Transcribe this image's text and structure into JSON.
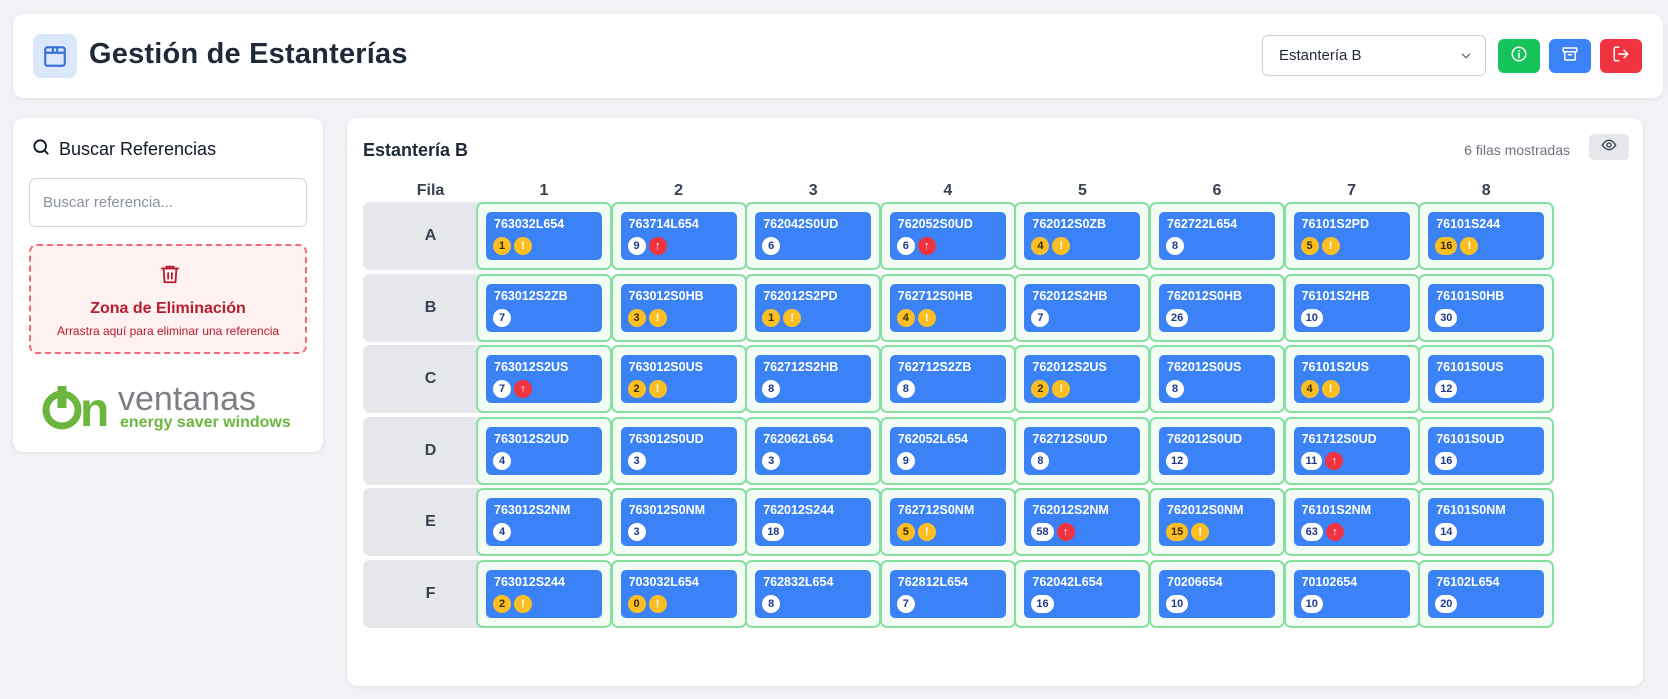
{
  "header": {
    "title": "Gestión de Estanterías",
    "selected_shelf": "Estantería B",
    "icons": [
      "package-icon",
      "info-icon",
      "archive-icon",
      "logout-icon"
    ]
  },
  "sidebar": {
    "search_title": "Buscar Referencias",
    "search_placeholder": "Buscar referencia...",
    "delete_zone_title": "Zona de Eliminación",
    "delete_zone_hint": "Arrastra aquí para eliminar una referencia",
    "brand_on": "on",
    "brand_name": "ventanas",
    "brand_tagline": "energy saver windows"
  },
  "main": {
    "title": "Estantería B",
    "rows_shown": "6 filas mostradas",
    "row_header_label": "Fila",
    "columns": [
      "1",
      "2",
      "3",
      "4",
      "5",
      "6",
      "7",
      "8"
    ],
    "rows": [
      {
        "label": "A",
        "cells": [
          {
            "ref": "763032L654",
            "qty": "1",
            "status": "warn"
          },
          {
            "ref": "763714L654",
            "qty": "9",
            "status": "up"
          },
          {
            "ref": "762042S0UD",
            "qty": "6",
            "status": "ok"
          },
          {
            "ref": "762052S0UD",
            "qty": "6",
            "status": "up"
          },
          {
            "ref": "762012S0ZB",
            "qty": "4",
            "status": "warn"
          },
          {
            "ref": "762722L654",
            "qty": "8",
            "status": "ok"
          },
          {
            "ref": "76101S2PD",
            "qty": "5",
            "status": "warn"
          },
          {
            "ref": "76101S244",
            "qty": "16",
            "status": "warn"
          }
        ]
      },
      {
        "label": "B",
        "cells": [
          {
            "ref": "763012S2ZB",
            "qty": "7",
            "status": "ok"
          },
          {
            "ref": "763012S0HB",
            "qty": "3",
            "status": "warn"
          },
          {
            "ref": "762012S2PD",
            "qty": "1",
            "status": "warn"
          },
          {
            "ref": "762712S0HB",
            "qty": "4",
            "status": "warn"
          },
          {
            "ref": "762012S2HB",
            "qty": "7",
            "status": "ok"
          },
          {
            "ref": "762012S0HB",
            "qty": "26",
            "status": "ok"
          },
          {
            "ref": "76101S2HB",
            "qty": "10",
            "status": "ok"
          },
          {
            "ref": "76101S0HB",
            "qty": "30",
            "status": "ok"
          }
        ]
      },
      {
        "label": "C",
        "cells": [
          {
            "ref": "763012S2US",
            "qty": "7",
            "status": "up"
          },
          {
            "ref": "763012S0US",
            "qty": "2",
            "status": "warn"
          },
          {
            "ref": "762712S2HB",
            "qty": "8",
            "status": "ok"
          },
          {
            "ref": "762712S2ZB",
            "qty": "8",
            "status": "ok"
          },
          {
            "ref": "762012S2US",
            "qty": "2",
            "status": "warn"
          },
          {
            "ref": "762012S0US",
            "qty": "8",
            "status": "ok"
          },
          {
            "ref": "76101S2US",
            "qty": "4",
            "status": "warn"
          },
          {
            "ref": "76101S0US",
            "qty": "12",
            "status": "ok"
          }
        ]
      },
      {
        "label": "D",
        "cells": [
          {
            "ref": "763012S2UD",
            "qty": "4",
            "status": "ok"
          },
          {
            "ref": "763012S0UD",
            "qty": "3",
            "status": "ok"
          },
          {
            "ref": "762062L654",
            "qty": "3",
            "status": "ok"
          },
          {
            "ref": "762052L654",
            "qty": "9",
            "status": "ok"
          },
          {
            "ref": "762712S0UD",
            "qty": "8",
            "status": "ok"
          },
          {
            "ref": "762012S0UD",
            "qty": "12",
            "status": "ok"
          },
          {
            "ref": "761712S0UD",
            "qty": "11",
            "status": "up"
          },
          {
            "ref": "76101S0UD",
            "qty": "16",
            "status": "ok"
          }
        ]
      },
      {
        "label": "E",
        "cells": [
          {
            "ref": "763012S2NM",
            "qty": "4",
            "status": "ok"
          },
          {
            "ref": "763012S0NM",
            "qty": "3",
            "status": "ok"
          },
          {
            "ref": "762012S244",
            "qty": "18",
            "status": "ok"
          },
          {
            "ref": "762712S0NM",
            "qty": "5",
            "status": "warn"
          },
          {
            "ref": "762012S2NM",
            "qty": "58",
            "status": "up"
          },
          {
            "ref": "762012S0NM",
            "qty": "15",
            "status": "warn"
          },
          {
            "ref": "76101S2NM",
            "qty": "63",
            "status": "up"
          },
          {
            "ref": "76101S0NM",
            "qty": "14",
            "status": "ok"
          }
        ]
      },
      {
        "label": "F",
        "cells": [
          {
            "ref": "763012S244",
            "qty": "2",
            "status": "warn"
          },
          {
            "ref": "703032L654",
            "qty": "0",
            "status": "warn"
          },
          {
            "ref": "762832L654",
            "qty": "8",
            "status": "ok"
          },
          {
            "ref": "762812L654",
            "qty": "7",
            "status": "ok"
          },
          {
            "ref": "762042L654",
            "qty": "16",
            "status": "ok"
          },
          {
            "ref": "70206654",
            "qty": "10",
            "status": "ok"
          },
          {
            "ref": "70102654",
            "qty": "10",
            "status": "ok"
          },
          {
            "ref": "76102L654",
            "qty": "20",
            "status": "ok"
          }
        ]
      }
    ]
  },
  "colors": {
    "card": "#3b82f6",
    "cell_border": "#86e09f",
    "warn": "#fbbf24",
    "alert": "#ef3340",
    "info_button": "#16c35a",
    "archive_button": "#3b82f6",
    "logout_button": "#ef3340"
  }
}
